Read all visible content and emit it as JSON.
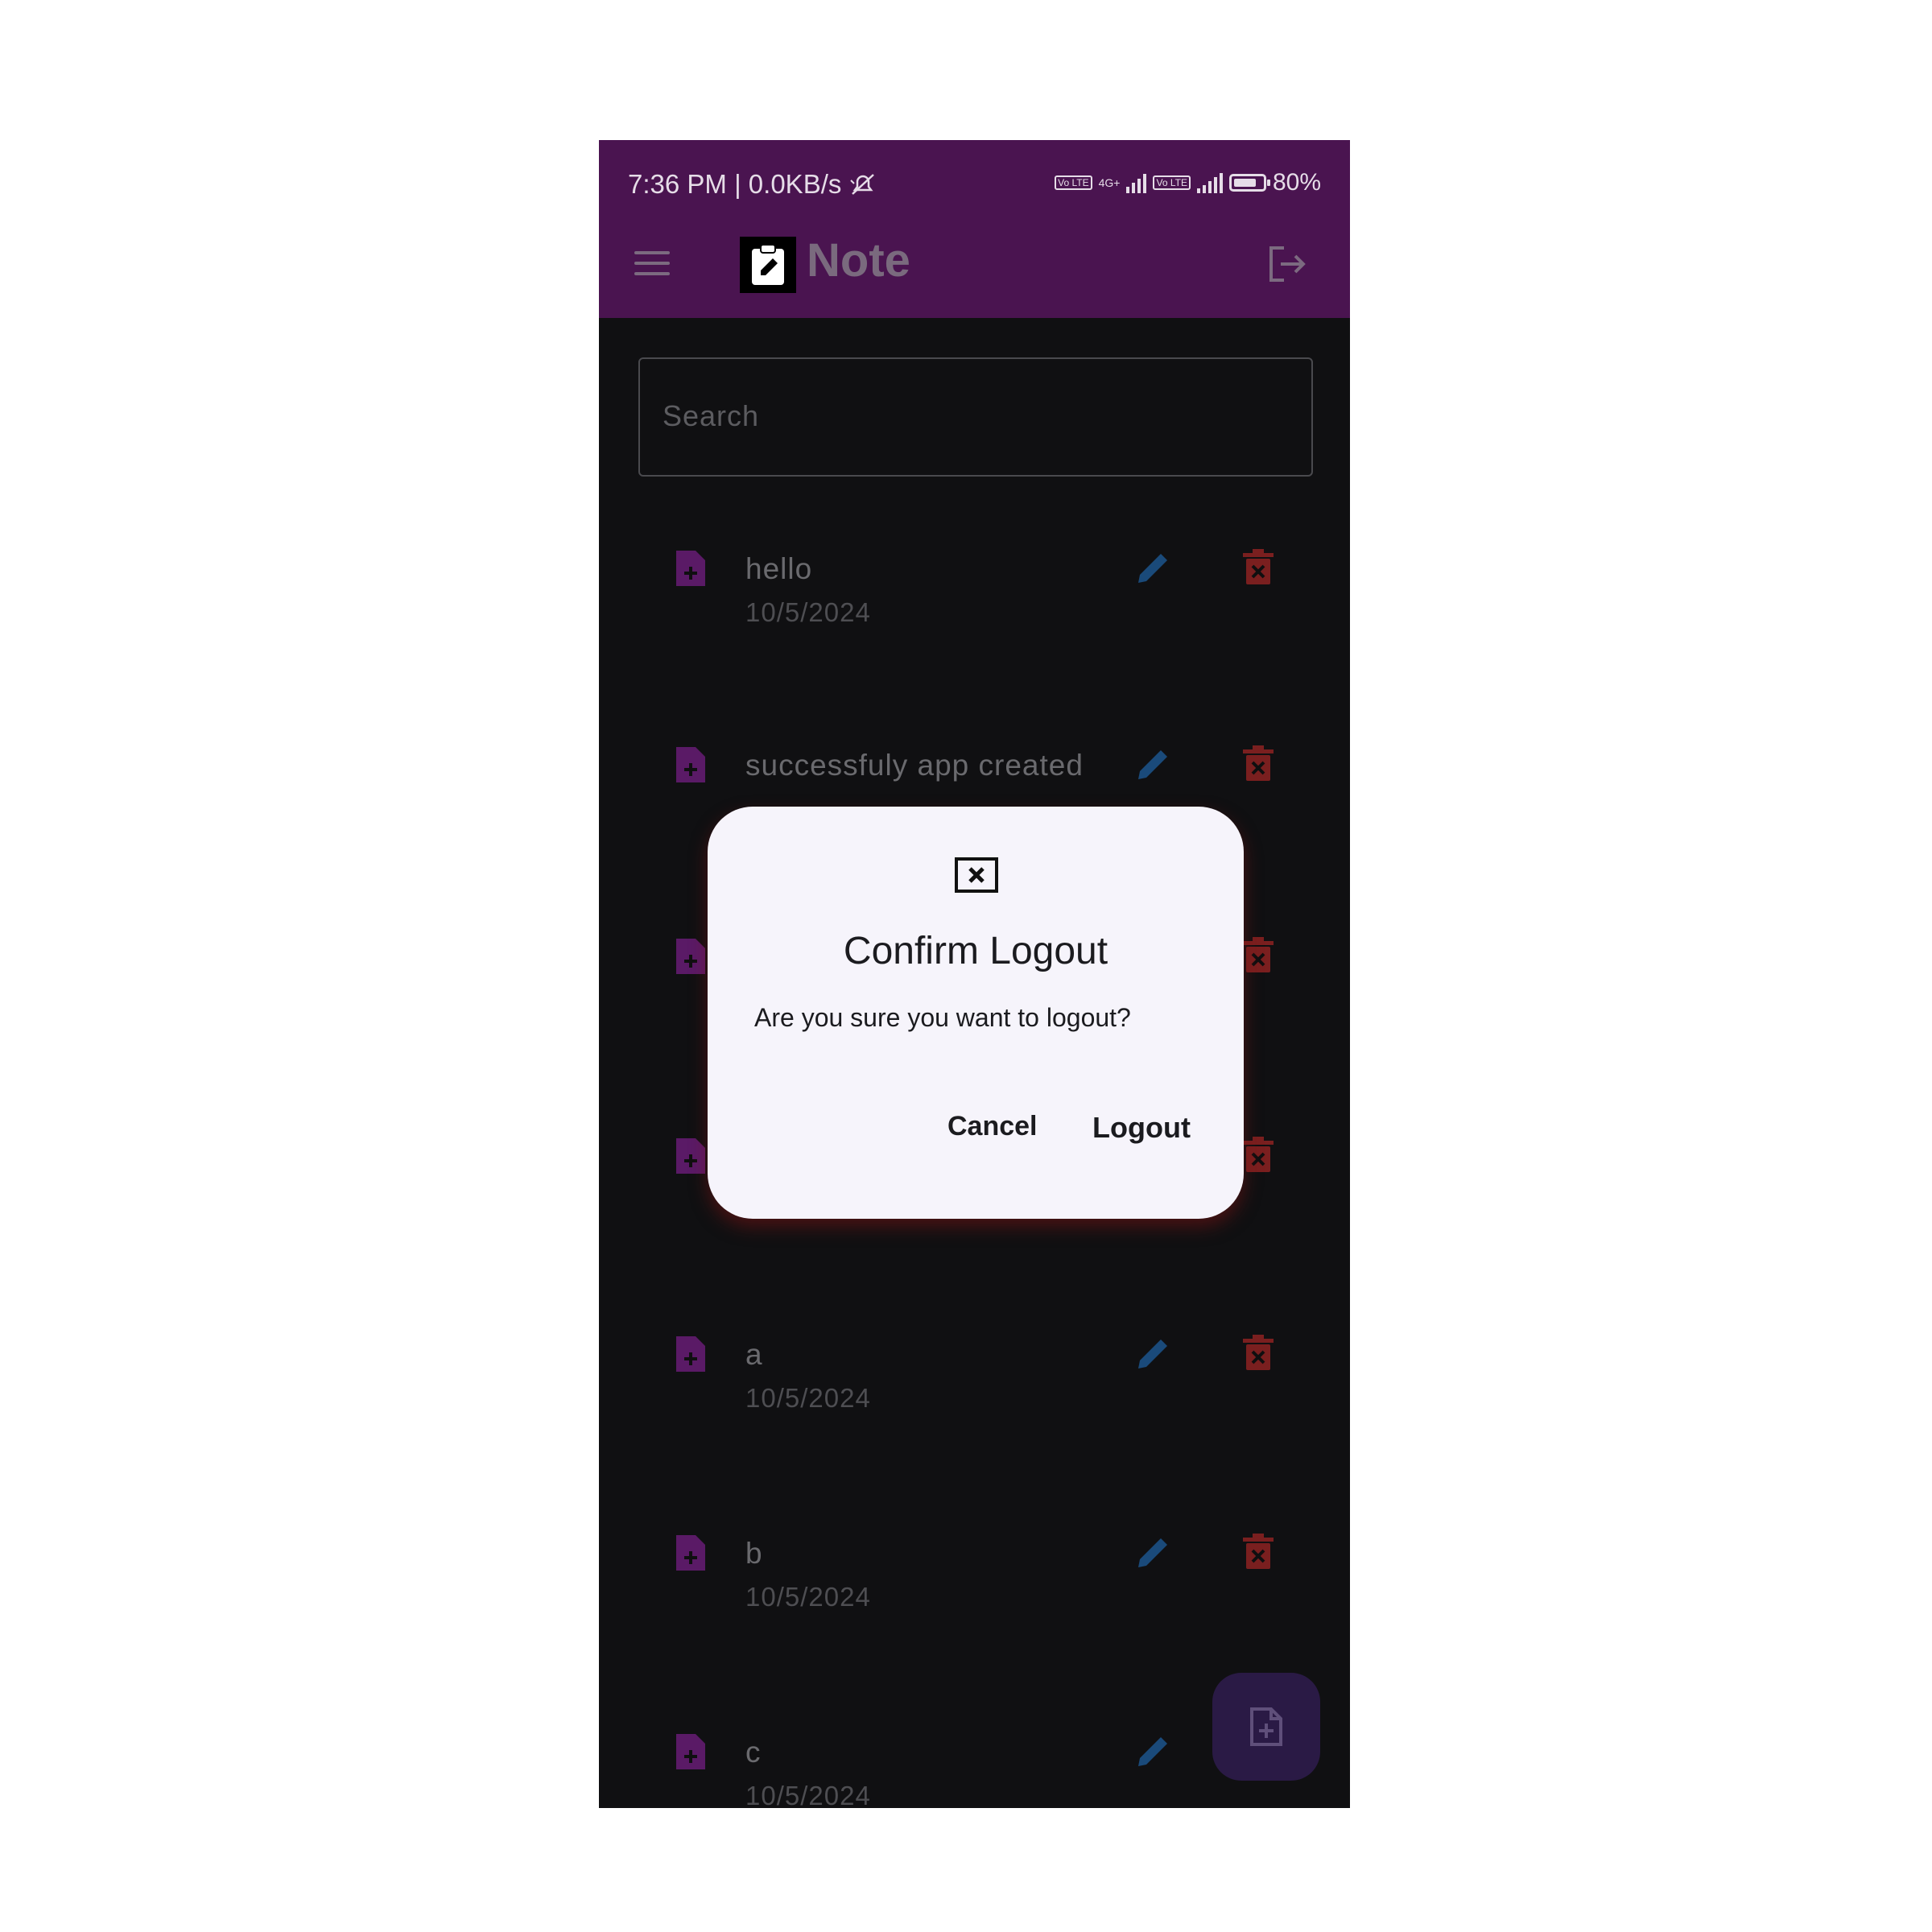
{
  "status_bar": {
    "time_text": "7:36 PM | 0.0KB/s",
    "network_label": "4G+",
    "lte_badge": "Vo LTE",
    "battery": "80%",
    "battery_level": 0.8
  },
  "app_bar": {
    "title": "Note"
  },
  "search": {
    "placeholder": "Search"
  },
  "notes": [
    {
      "title": "hello",
      "date": "10/5/2024"
    },
    {
      "title": "successfuly app created",
      "date": ""
    },
    {
      "title": "",
      "date": ""
    },
    {
      "title": "",
      "date": ""
    },
    {
      "title": "a",
      "date": "10/5/2024"
    },
    {
      "title": "b",
      "date": "10/5/2024"
    },
    {
      "title": "c",
      "date": "10/5/2024"
    }
  ],
  "dialog": {
    "title": "Confirm Logout",
    "message": "Are you sure you want to logout?",
    "cancel_label": "Cancel",
    "logout_label": "Logout"
  },
  "colors": {
    "app_bar": "#4a1450",
    "background": "#101012",
    "file_icon": "#5a1a66",
    "edit_icon": "#1a4a7a",
    "delete_icon": "#7a1f1f",
    "dialog_bg": "#f6f4fb"
  },
  "icons": {
    "menu": "menu-icon",
    "logo": "clipboard-edit-icon",
    "logout": "logout-icon",
    "note": "file-plus-icon",
    "edit": "pencil-icon",
    "delete": "trash-x-icon",
    "fab": "file-plus-icon",
    "dialog": "close-box-icon"
  }
}
